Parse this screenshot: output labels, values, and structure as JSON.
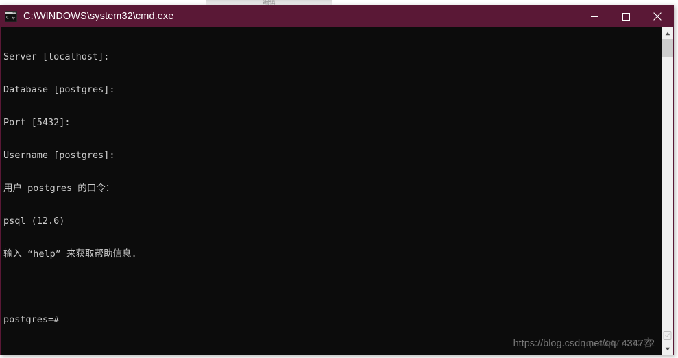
{
  "window": {
    "title": "C:\\WINDOWS\\system32\\cmd.exe",
    "icon": "cmd-console-icon",
    "titlebar_color": "#5a1836",
    "background_color": "#0c0c0c",
    "text_color": "#cccccc",
    "controls": {
      "minimize_label": "Minimize",
      "maximize_label": "Maximize",
      "close_label": "Close"
    }
  },
  "top_remnant": {
    "text": "编辑"
  },
  "console": {
    "lines": [
      "Server [localhost]:",
      "Database [postgres]:",
      "Port [5432]:",
      "Username [postgres]:",
      "用户 postgres 的口令：",
      "psql (12.6)",
      "输入 “help” 来获取帮助信息.",
      "",
      "postgres=#"
    ],
    "prompt": "postgres=#"
  },
  "watermark": {
    "text": "https://blog.csdn.net/qq_434772",
    "overlay_text": "qq_43477212容"
  },
  "scrollbar": {
    "up_arrow": "chevron-up-icon",
    "down_arrow": "chevron-down-icon",
    "thumb_label": "scroll-thumb"
  }
}
